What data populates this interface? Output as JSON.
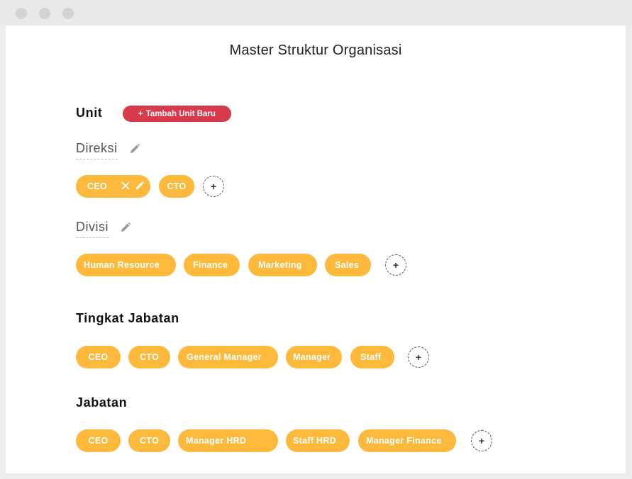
{
  "title": "Master Struktur Organisasi",
  "unit": {
    "heading": "Unit",
    "add_button_label": "Tambah Unit Baru",
    "add_button_icon": "+",
    "direksi": {
      "label": "Direksi",
      "items": [
        "CEO",
        "CTO"
      ]
    },
    "divisi": {
      "label": "Divisi",
      "items": [
        "Human Resource",
        "Finance",
        "Marketing",
        "Sales"
      ]
    }
  },
  "tingkat_jabatan": {
    "heading": "Tingkat Jabatan",
    "items": [
      "CEO",
      "CTO",
      "General Manager",
      "Manager",
      "Staff"
    ]
  },
  "jabatan": {
    "heading": "Jabatan",
    "items": [
      "CEO",
      "CTO",
      "Manager HRD",
      "Staff HRD",
      "Manager Finance"
    ]
  },
  "add_icon": "+",
  "colors": {
    "chip": "#fdb93b",
    "accent_button": "#d63a4b"
  }
}
